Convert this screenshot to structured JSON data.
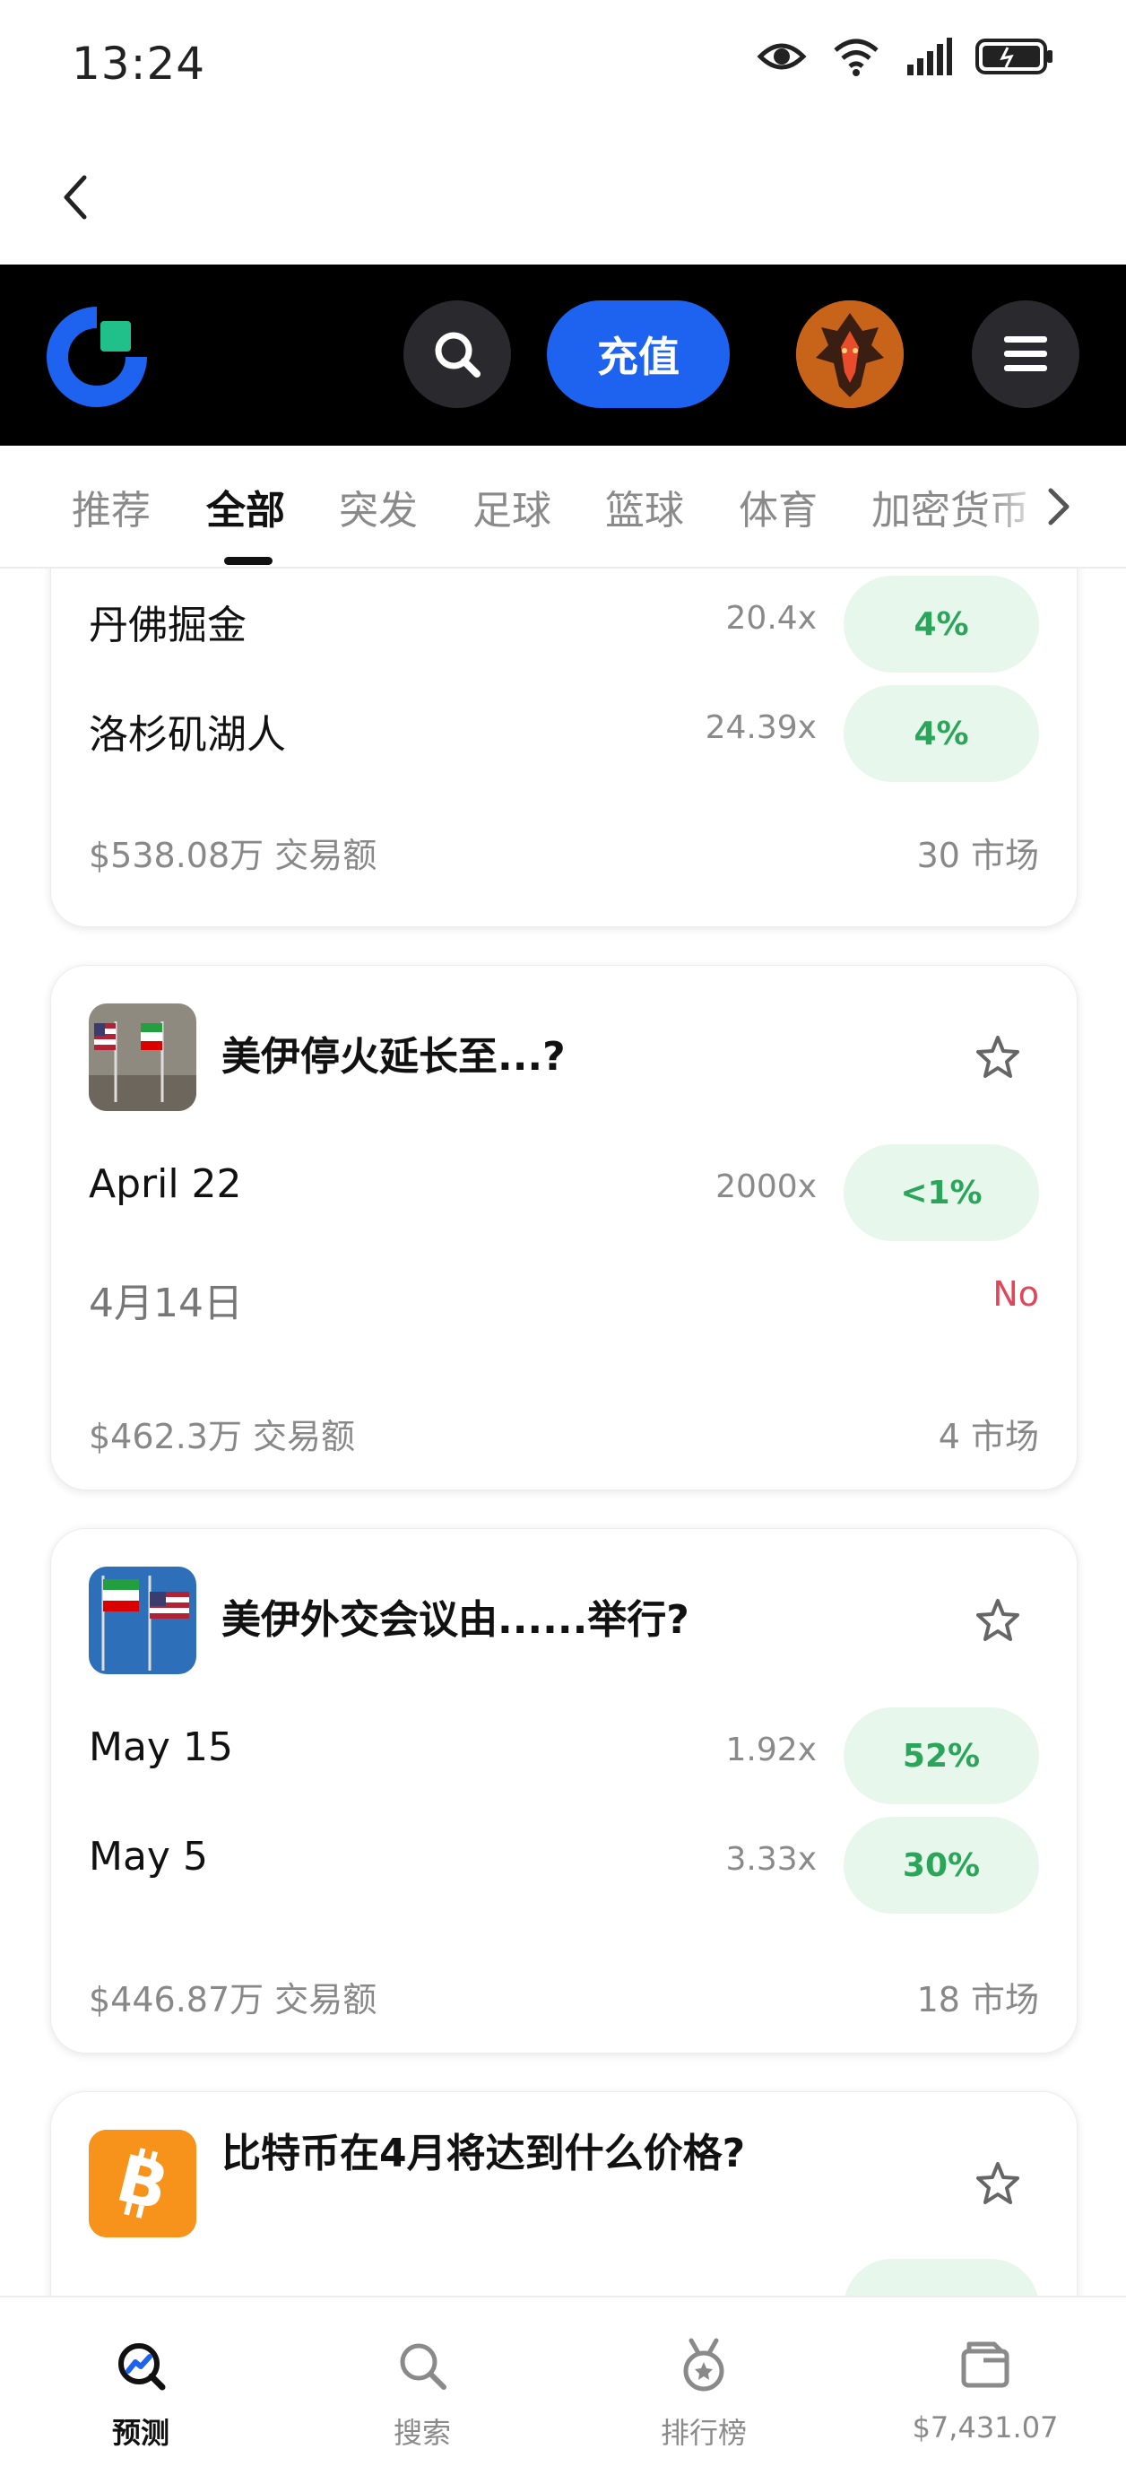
{
  "status_bar": {
    "time": "13:24"
  },
  "header": {
    "recharge_label": "充值"
  },
  "tabs": [
    {
      "label": "推荐",
      "active": false
    },
    {
      "label": "全部",
      "active": true
    },
    {
      "label": "突发",
      "active": false
    },
    {
      "label": "足球",
      "active": false
    },
    {
      "label": "篮球",
      "active": false
    },
    {
      "label": "体育",
      "active": false
    },
    {
      "label": "加密货币",
      "active": false
    }
  ],
  "cards": [
    {
      "title": "",
      "rows": [
        {
          "label": "丹佛掘金",
          "multiplier": "20.4x",
          "pct": "4%"
        },
        {
          "label": "洛杉矶湖人",
          "multiplier": "24.39x",
          "pct": "4%"
        }
      ],
      "volume": "$538.08万 交易额",
      "markets": "30 市场"
    },
    {
      "title": "美伊停火延长至...?",
      "thumb": "us-iran-flags",
      "rows": [
        {
          "label": "April 22",
          "multiplier": "2000x",
          "pct": "<1%"
        }
      ],
      "resolved": {
        "label": "4月14日",
        "outcome": "No"
      },
      "volume": "$462.3万 交易额",
      "markets": "4 市场"
    },
    {
      "title": "美伊外交会议由......举行?",
      "thumb": "iran-us-flags",
      "rows": [
        {
          "label": "May 15",
          "multiplier": "1.92x",
          "pct": "52%"
        },
        {
          "label": "May 5",
          "multiplier": "3.33x",
          "pct": "30%"
        }
      ],
      "volume": "$446.87万 交易额",
      "markets": "18 市场"
    },
    {
      "title": "比特币在4月将达到什么价格?",
      "thumb": "bitcoin"
    }
  ],
  "bottom_nav": [
    {
      "label": "预测",
      "icon": "predict-icon",
      "active": true
    },
    {
      "label": "搜索",
      "icon": "search-icon",
      "active": false
    },
    {
      "label": "排行榜",
      "icon": "medal-icon",
      "active": false
    },
    {
      "label": "$7,431.07",
      "icon": "wallet-icon",
      "active": false
    }
  ],
  "colors": {
    "accent": "#1e63f0",
    "positive": "#2aa55a",
    "positive_bg": "#e7f7ec",
    "negative": "#e0455a",
    "appbar": "#000000"
  }
}
